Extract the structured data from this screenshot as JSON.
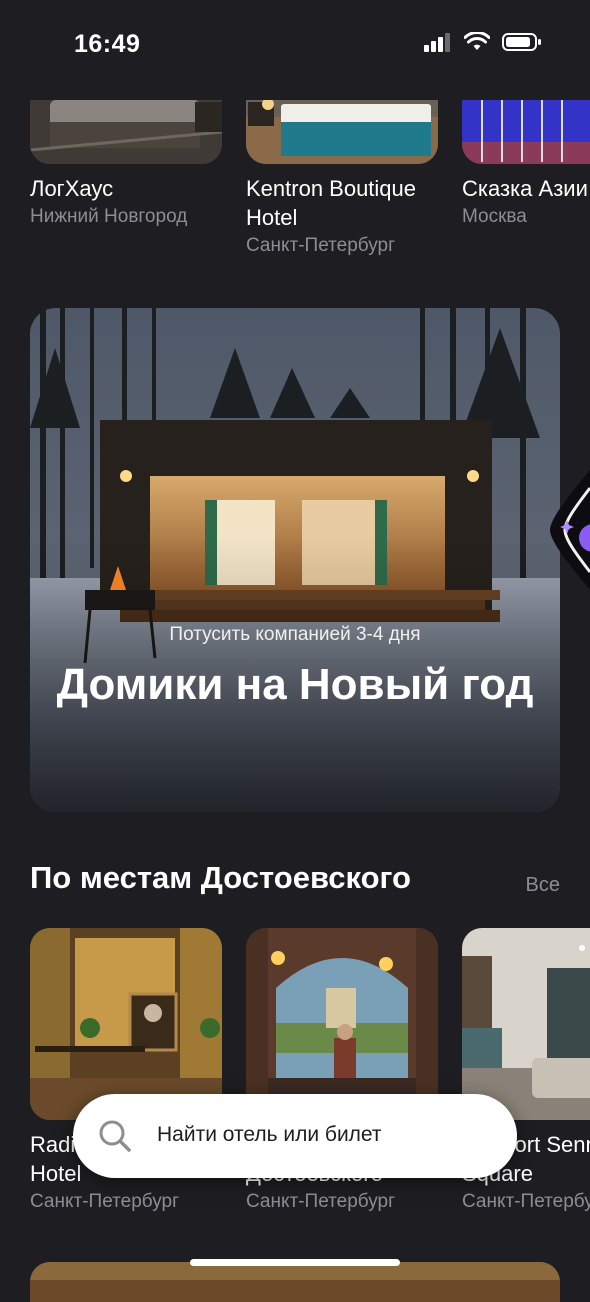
{
  "status": {
    "time": "16:49"
  },
  "top_cards": [
    {
      "name": "ЛогХаус",
      "city": "Нижний Новгород"
    },
    {
      "name": "Kentron Boutique Hotel",
      "city": "Санкт-Петербург"
    },
    {
      "name": "Сказка Азии",
      "city": "Москва"
    }
  ],
  "promo": {
    "subtitle": "Потусить компанией 3-4 дня",
    "title": "Домики на Новый год"
  },
  "section": {
    "title": "По местам Достоевского",
    "all_label": "Все",
    "cards": [
      {
        "name": "Radisson Sonya Hotel",
        "city": "Санкт-Петербург"
      },
      {
        "name": "Отель Достоевского",
        "city": "Санкт-Петербург"
      },
      {
        "name": "Comfort Sennaya Square",
        "city": "Санкт-Петербург"
      }
    ]
  },
  "search": {
    "placeholder": "Найти отель или билет"
  },
  "colors": {
    "background": "#1e1d21",
    "secondary_text": "#8e8d93",
    "accent": "#8a5cf6"
  }
}
